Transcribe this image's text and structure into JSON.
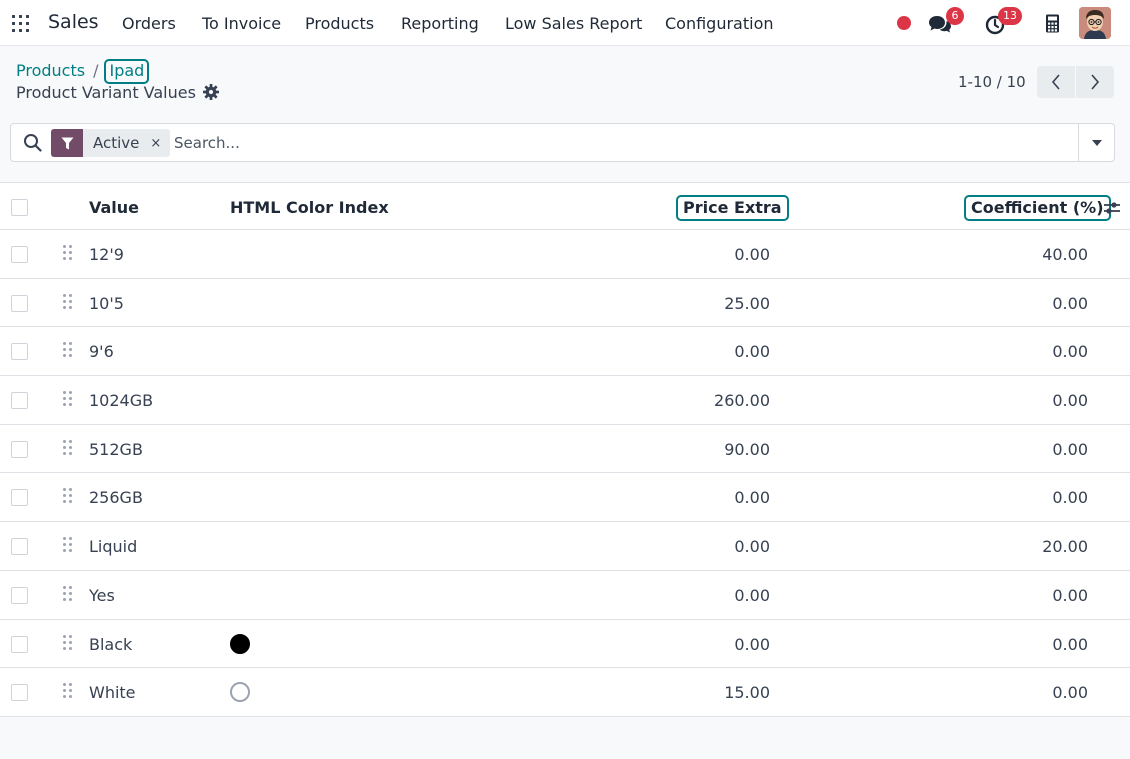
{
  "navbar": {
    "app_name": "Sales",
    "menu": [
      "Orders",
      "To Invoice",
      "Products",
      "Reporting",
      "Low Sales Report",
      "Configuration"
    ],
    "messages_count": "6",
    "activities_count": "13"
  },
  "breadcrumb": {
    "parent": "Products",
    "separator": "/",
    "current": "Ipad"
  },
  "subtitle": "Product Variant Values",
  "pager": {
    "value": "1-10 / 10"
  },
  "search": {
    "facet": "Active",
    "facet_remove": "×",
    "placeholder": "Search..."
  },
  "table": {
    "headers": {
      "value": "Value",
      "color": "HTML Color Index",
      "price": "Price Extra",
      "coefficient": "Coefficient (%)"
    },
    "rows": [
      {
        "value": "12'9",
        "color": null,
        "price": "0.00",
        "coefficient": "40.00"
      },
      {
        "value": "10'5",
        "color": null,
        "price": "25.00",
        "coefficient": "0.00"
      },
      {
        "value": "9'6",
        "color": null,
        "price": "0.00",
        "coefficient": "0.00"
      },
      {
        "value": "1024GB",
        "color": null,
        "price": "260.00",
        "coefficient": "0.00"
      },
      {
        "value": "512GB",
        "color": null,
        "price": "90.00",
        "coefficient": "0.00"
      },
      {
        "value": "256GB",
        "color": null,
        "price": "0.00",
        "coefficient": "0.00"
      },
      {
        "value": "Liquid",
        "color": null,
        "price": "0.00",
        "coefficient": "20.00"
      },
      {
        "value": "Yes",
        "color": null,
        "price": "0.00",
        "coefficient": "0.00"
      },
      {
        "value": "Black",
        "color": "#000000",
        "price": "0.00",
        "coefficient": "0.00"
      },
      {
        "value": "White",
        "color": "#ffffff",
        "price": "15.00",
        "coefficient": "0.00"
      }
    ]
  },
  "colors": {
    "brand_teal": "#017e84",
    "filter_purple": "#714b67",
    "badge_red": "#dc3545"
  }
}
